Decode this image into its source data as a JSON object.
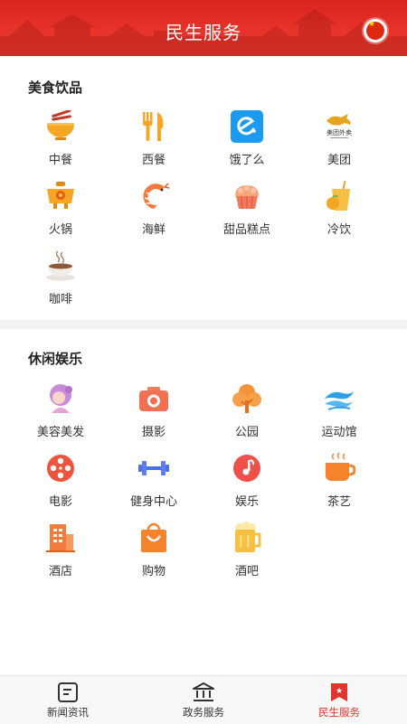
{
  "header": {
    "title": "民生服务"
  },
  "sections": [
    {
      "title": "美食饮品",
      "items": [
        {
          "label": "中餐",
          "icon": "noodle-bowl-icon"
        },
        {
          "label": "西餐",
          "icon": "fork-knife-icon"
        },
        {
          "label": "饿了么",
          "icon": "eleme-logo-icon"
        },
        {
          "label": "美团",
          "icon": "meituan-kangaroo-icon"
        },
        {
          "label": "火锅",
          "icon": "hotpot-icon"
        },
        {
          "label": "海鲜",
          "icon": "shrimp-icon"
        },
        {
          "label": "甜品糕点",
          "icon": "cake-icon"
        },
        {
          "label": "冷饮",
          "icon": "cold-drink-icon"
        },
        {
          "label": "咖啡",
          "icon": "coffee-cup-icon"
        }
      ]
    },
    {
      "title": "休闲娱乐",
      "items": [
        {
          "label": "美容美发",
          "icon": "hair-salon-icon"
        },
        {
          "label": "摄影",
          "icon": "camera-icon"
        },
        {
          "label": "公园",
          "icon": "tree-icon"
        },
        {
          "label": "运动馆",
          "icon": "wave-icon"
        },
        {
          "label": "电影",
          "icon": "film-reel-icon"
        },
        {
          "label": "健身中心",
          "icon": "dumbbell-icon"
        },
        {
          "label": "娱乐",
          "icon": "music-note-icon"
        },
        {
          "label": "茶艺",
          "icon": "tea-cup-icon"
        },
        {
          "label": "酒店",
          "icon": "hotel-building-icon"
        },
        {
          "label": "购物",
          "icon": "shopping-bag-icon"
        },
        {
          "label": "酒吧",
          "icon": "beer-mug-icon"
        }
      ]
    }
  ],
  "meituan_logo_text": "美团外卖",
  "tabbar": [
    {
      "label": "新闻资讯",
      "icon": "news-icon",
      "active": false
    },
    {
      "label": "政务服务",
      "icon": "government-building-icon",
      "active": false
    },
    {
      "label": "民生服务",
      "icon": "ribbon-star-icon",
      "active": true
    }
  ],
  "colors": {
    "header_red": "#e0342c",
    "active_tab": "#e0342c"
  }
}
